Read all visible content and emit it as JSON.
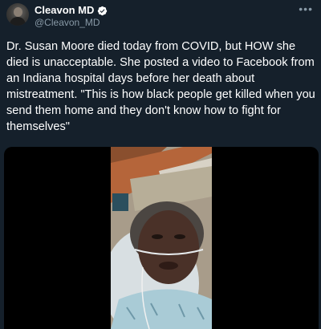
{
  "tweet": {
    "author": {
      "display_name": "Cleavon MD",
      "handle": "@Cleavon_MD",
      "verified": true
    },
    "more_icon": "more-icon",
    "text": "Dr. Susan Moore died today from COVID, but HOW she died is unacceptable. She posted a video to Facebook from an Indiana hospital days before her death about mistreatment. \"This is how black people get killed when you send them home and they don't know how to fight for themselves\""
  },
  "colors": {
    "background": "#15202b",
    "text": "#ffffff",
    "secondary_text": "#8899a6",
    "verified_badge": "#ffffff"
  }
}
